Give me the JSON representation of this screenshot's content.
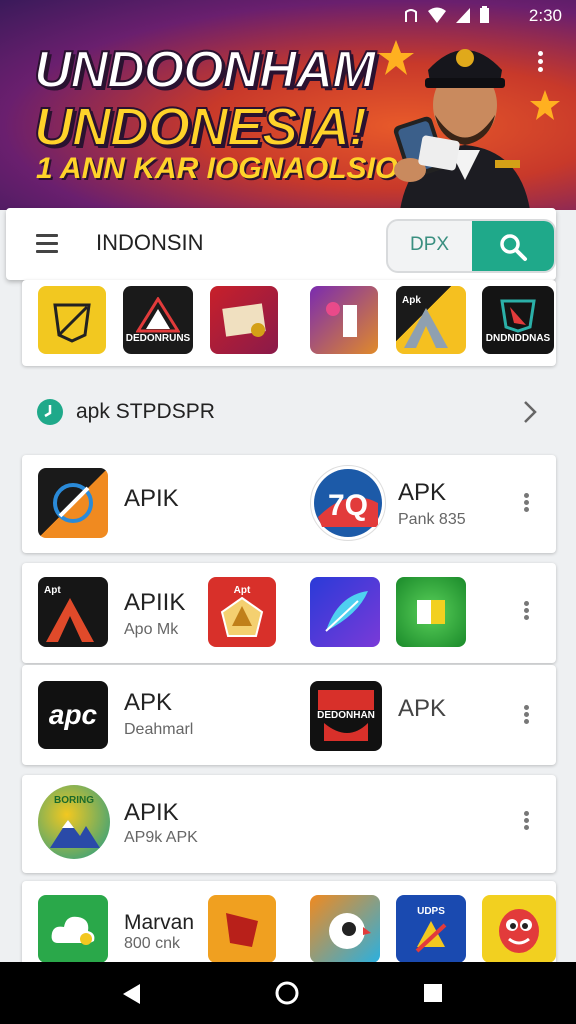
{
  "status_bar": {
    "time": "2:30"
  },
  "banner": {
    "line1": "UNDOONHAM",
    "line2": "UNDONESIA!",
    "line3": "1 ANN KAR IOGNAOLSIO.X  7"
  },
  "search": {
    "menu_label": "INDONSIN",
    "filter_label": "DPX"
  },
  "top_strip": {
    "tile_labels": [
      "",
      "DEDONRUNS",
      "",
      "",
      "Apk",
      "DNDNDDNAS"
    ]
  },
  "section": {
    "title": "apk STPDSPR"
  },
  "rows": [
    {
      "left_title": "APIK",
      "left_sub": "",
      "right_title": "APK",
      "right_sub": "Pank 835"
    },
    {
      "left_title": "APIIK",
      "left_sub": "Apo Mk",
      "right_title": "",
      "right_sub": ""
    },
    {
      "left_title": "APK",
      "left_sub": "Deahmarl",
      "right_title": "APK",
      "right_sub": ""
    },
    {
      "left_title": "APIK",
      "left_sub": "AP9k APK",
      "right_title": "",
      "right_sub": ""
    },
    {
      "left_title": "Marvan",
      "left_sub": "800 cnk",
      "right_title": "",
      "right_sub": ""
    }
  ],
  "icon_text": {
    "apc": "apc",
    "ap_tile": "Apt",
    "ap_tile2": "Apt",
    "dedon": "DEDONHAN",
    "boning": "BORING",
    "udes": "UDPS",
    "apk_strip": "Apk"
  },
  "colors": {
    "accent": "#1fa98a",
    "banner_yellow": "#ffd32a"
  }
}
